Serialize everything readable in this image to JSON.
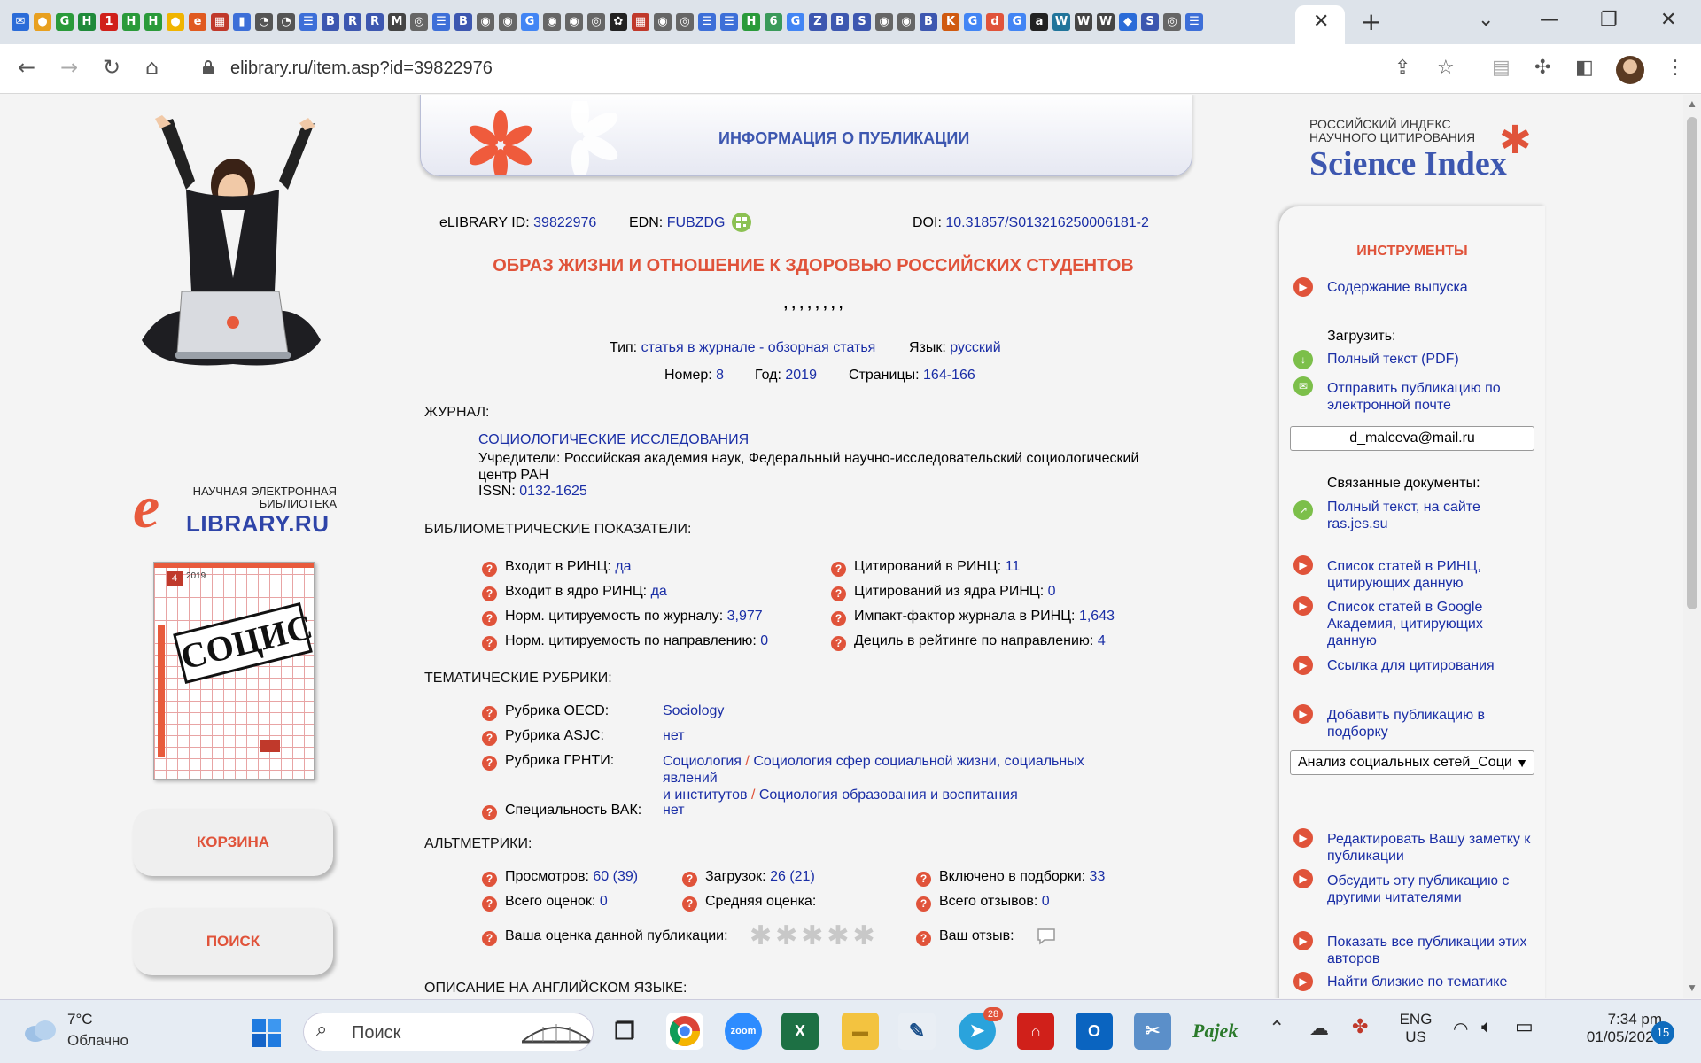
{
  "browser": {
    "tab_close_glyph": "✕",
    "new_tab_glyph": "+",
    "url": "elibrary.ru/item.asp?id=39822976",
    "tab_icon_glyphs": [
      "✉",
      "●",
      "G",
      "H",
      "1",
      "H",
      "H",
      "●",
      "e",
      "▦",
      "▮",
      "◔",
      "◔",
      "☰",
      "B",
      "R",
      "R",
      "M",
      "◎",
      "☰",
      "B",
      "◉",
      "◉",
      "G",
      "◉",
      "◉",
      "◎",
      "✿",
      "▦",
      "◉",
      "◎",
      "☰",
      "☰",
      "H",
      "6",
      "G",
      "Z",
      "B",
      "S",
      "◉",
      "◉",
      "B",
      "K",
      "G",
      "d",
      "G",
      "a",
      "W",
      "W",
      "W",
      "◆",
      "S",
      "◎",
      "☰"
    ]
  },
  "banner": {
    "title": "ИНФОРМАЦИЯ О ПУБЛИКАЦИИ"
  },
  "elibrary_logo": {
    "letter": "e",
    "line1": "НАУЧНАЯ ЭЛЕКТРОННАЯ",
    "line2": "БИБЛИОТЕКА",
    "line3": "LIBRARY.RU"
  },
  "cover": {
    "title": "СОЦИС",
    "year": "2019",
    "issue": "4"
  },
  "left_buttons": {
    "cart": "КОРЗИНА",
    "search": "ПОИСК"
  },
  "science_index": {
    "line1": "РОССИЙСКИЙ ИНДЕКС",
    "line2": "НАУЧНОГО ЦИТИРОВАНИЯ",
    "name": "Science Index",
    "star": "✱"
  },
  "ids": {
    "elibrary_label": "eLIBRARY ID:",
    "elibrary_value": "39822976",
    "edn_label": "EDN:",
    "edn_value": "FUBZDG",
    "doi_label": "DOI:",
    "doi_value": "10.31857/S013216250006181-2"
  },
  "article": {
    "title": "ОБРАЗ ЖИЗНИ И ОТНОШЕНИЕ К ЗДОРОВЬЮ РОССИЙСКИХ СТУДЕНТОВ",
    "authors": ", , , , , , , ,",
    "type_label": "Тип:",
    "type_value": "статья в журнале - обзорная статья",
    "lang_label": "Язык:",
    "lang_value": "русский",
    "number_label": "Номер:",
    "number_value": "8",
    "year_label": "Год:",
    "year_value": "2019",
    "pages_label": "Страницы:",
    "pages_value": "164-166"
  },
  "journal": {
    "heading": "ЖУРНАЛ:",
    "name": "СОЦИОЛОГИЧЕСКИЕ ИССЛЕДОВАНИЯ",
    "founders_line1": "Учредители: Российская академия наук, Федеральный научно-исследовательский социологический",
    "founders_line2": "центр РАН",
    "issn_label": "ISSN:",
    "issn_value": "0132-1625"
  },
  "biblio": {
    "heading": "БИБЛИОМЕТРИЧЕСКИЕ ПОКАЗАТЕЛИ:",
    "left": [
      {
        "label": "Входит в РИНЦ:",
        "value": "да"
      },
      {
        "label": "Входит в ядро РИНЦ:",
        "value": "да"
      },
      {
        "label": "Норм. цитируемость по журналу:",
        "value": "3,977"
      },
      {
        "label": "Норм. цитируемость по направлению:",
        "value": "0"
      }
    ],
    "right": [
      {
        "label": "Цитирований в РИНЦ:",
        "value": "11"
      },
      {
        "label": "Цитирований из ядра РИНЦ:",
        "value": "0"
      },
      {
        "label": "Импакт-фактор журнала в РИНЦ:",
        "value": "1,643"
      },
      {
        "label": "Дециль в рейтинге по направлению:",
        "value": "4"
      }
    ]
  },
  "rubrics": {
    "heading": "ТЕМАТИЧЕСКИЕ РУБРИКИ:",
    "oecd_label": "Рубрика OECD:",
    "oecd_value": "Sociology",
    "asjc_label": "Рубрика ASJC:",
    "asjc_value": "нет",
    "grnti_label": "Рубрика ГРНТИ:",
    "grnti_1": "Социология",
    "grnti_sep": "/",
    "grnti_2a": "Социология сфер социальной жизни, социальных явлений",
    "grnti_2b": "и институтов",
    "grnti_3": "Социология образования и воспитания",
    "vak_label": "Специальность ВАК:",
    "vak_value": "нет"
  },
  "altmetrics": {
    "heading": "АЛЬТМЕТРИКИ:",
    "views_label": "Просмотров:",
    "views_value": "60 (39)",
    "downloads_label": "Загрузок:",
    "downloads_value": "26 (21)",
    "collections_label": "Включено в подборки:",
    "collections_value": "33",
    "ratings_label": "Всего оценок:",
    "ratings_value": "0",
    "avg_label": "Средняя оценка:",
    "reviews_label": "Всего отзывов:",
    "reviews_value": "0",
    "your_rating_label": "Ваша оценка данной публикации:",
    "your_review_label": "Ваш отзыв:",
    "stars": "✱✱✱✱✱"
  },
  "english_heading": "ОПИСАНИЕ НА АНГЛИЙСКОМ ЯЗЫКЕ:",
  "tools": {
    "heading": "ИНСТРУМЕНТЫ",
    "issue_contents": "Содержание выпуска",
    "download_label": "Загрузить:",
    "full_text_pdf": "Полный текст (PDF)",
    "send_email_1": "Отправить публикацию по",
    "send_email_2": "электронной почте",
    "email_value": "d_malceva@mail.ru",
    "related_label": "Связанные документы:",
    "full_text_site_1": "Полный текст, на сайте",
    "full_text_site_2": "ras.jes.su",
    "rinc_list_1": "Список статей в РИНЦ,",
    "rinc_list_2": "цитирующих данную",
    "google_list_1": "Список статей в Google",
    "google_list_2": "Академия, цитирующих",
    "google_list_3": "данную",
    "cite_link": "Ссылка для цитирования",
    "add_to_collection_1": "Добавить публикацию в",
    "add_to_collection_2": "подборку",
    "collection_selected": "Анализ социальных сетей_Соци",
    "edit_note_1": "Редактировать Вашу заметку к",
    "edit_note_2": "публикации",
    "discuss_1": "Обсудить эту публикацию с",
    "discuss_2": "другими читателями",
    "show_all_1": "Показать все публикации этих",
    "show_all_2": "авторов",
    "find_similar": "Найти близкие по тематике"
  },
  "taskbar": {
    "weather_temp": "7°C",
    "weather_desc": "Облачно",
    "search_placeholder": "Поиск",
    "zoom_label": "zoom",
    "telegram_badge": "28",
    "lang_1": "ENG",
    "lang_2": "US",
    "time": "7:34 pm",
    "date": "01/05/2023",
    "notif_count": "15"
  },
  "colors": {
    "accent_orange": "#e0533a",
    "link_blue": "#1a2ea6",
    "header_blue": "#3d57b0",
    "green_icon": "#7cbf4a"
  }
}
